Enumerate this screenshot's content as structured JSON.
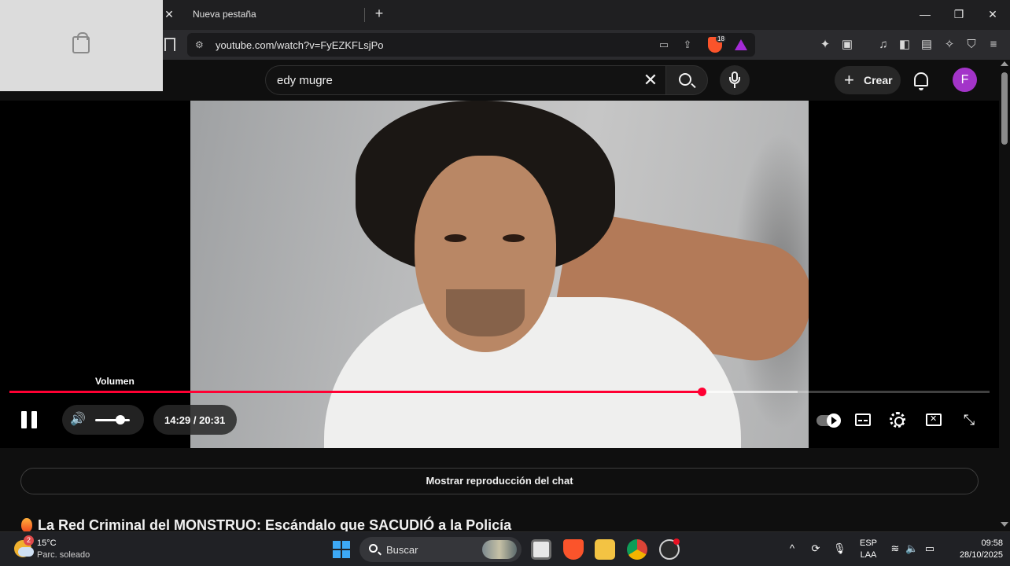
{
  "browser": {
    "tab_title": "Nueva pestaña",
    "tab_close": "✕",
    "new_tab": "+",
    "url": "youtube.com/watch?v=FyEZKFLsjPo",
    "shield_count": "18",
    "window_controls": {
      "minimize": "—",
      "maximize": "❐",
      "close": "✕"
    }
  },
  "youtube": {
    "search_value": "edy mugre",
    "search_clear": "✕",
    "create_label": "Crear",
    "create_plus": "+",
    "avatar_letter": "F"
  },
  "player": {
    "volume_tooltip": "Volumen",
    "current_time": "14:29",
    "duration": "20:31",
    "time_display": "14:29 / 20:31",
    "progress_fraction": 0.706,
    "volume_level": 0.72,
    "speaker_glyph": "🔊",
    "fullscreen_glyph": "⤡"
  },
  "page": {
    "chat_replay_label": "Mostrar reproducción del chat",
    "video_title": "La Red Criminal del MONSTRUO: Escándalo que SACUDIÓ a la Policía"
  },
  "taskbar": {
    "weather_badge": "2",
    "weather_temp": "15°C",
    "weather_desc": "Parc. soleado",
    "search_label": "Buscar",
    "language_top": "ESP",
    "language_bottom": "LAA",
    "time": "09:58",
    "date": "28/10/2025",
    "tray_chevron": "^"
  },
  "colors": {
    "progress": "#ff0033",
    "avatar": "#a334c9",
    "brave_orange": "#fb542b"
  }
}
